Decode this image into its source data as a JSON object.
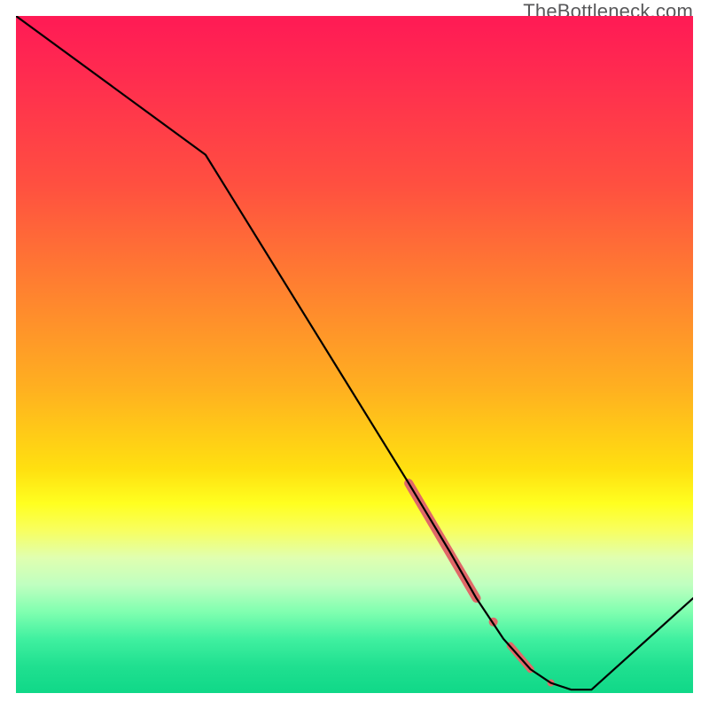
{
  "attribution": "TheBottleneck.com",
  "chart_data": {
    "type": "line",
    "title": "",
    "xlabel": "",
    "ylabel": "",
    "xlim": [
      0,
      100
    ],
    "ylim": [
      0,
      100
    ],
    "background": "rainbow_vertical_red_to_green",
    "series": [
      {
        "name": "bottleneck-curve",
        "stroke": "#000000",
        "x": [
          0,
          28,
          58,
          64,
          68,
          72,
          76,
          79,
          82,
          85,
          100
        ],
        "values": [
          100,
          79.5,
          31,
          21,
          14,
          8,
          3.5,
          1.5,
          0.5,
          0.5,
          14
        ]
      }
    ],
    "markers": [
      {
        "name": "highlight-segment-thick",
        "type": "line_segment",
        "stroke": "#e06868",
        "stroke_width": 10,
        "x1": 58,
        "y1": 31,
        "x2": 68,
        "y2": 14
      },
      {
        "name": "highlight-dot-1",
        "type": "circle",
        "fill": "#e06868",
        "cx": 70.5,
        "cy": 10.5,
        "r": 5
      },
      {
        "name": "highlight-segment-mid",
        "type": "line_segment",
        "stroke": "#e06868",
        "stroke_width": 8,
        "x1": 73,
        "y1": 7,
        "x2": 76,
        "y2": 3.5
      },
      {
        "name": "highlight-dot-2",
        "type": "circle",
        "fill": "#e06868",
        "cx": 79,
        "cy": 1.5,
        "r": 4
      },
      {
        "name": "highlight-dot-3",
        "type": "circle",
        "fill": "#e06868",
        "cx": 76,
        "cy": 3.5,
        "r": 4
      }
    ]
  }
}
